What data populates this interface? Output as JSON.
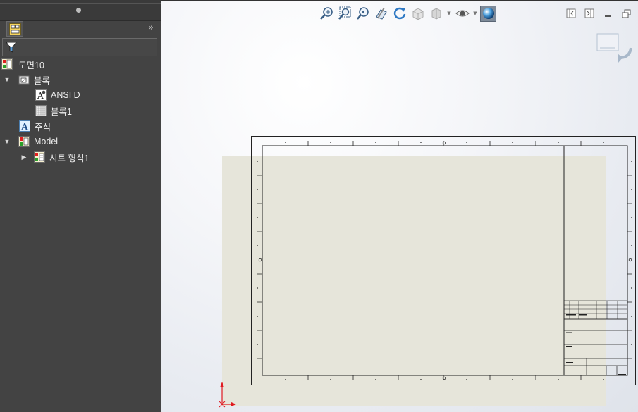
{
  "feature_tree": {
    "items": [
      {
        "label": "도면10",
        "icon": "drawing-document-icon",
        "expander": ""
      },
      {
        "label": "블록",
        "icon": "blocks-folder-icon",
        "expander": "▼"
      },
      {
        "label": "ANSI D",
        "icon": "block-icon",
        "expander": ""
      },
      {
        "label": "블록1",
        "icon": "block-icon",
        "expander": ""
      },
      {
        "label": "주석",
        "icon": "annotations-icon",
        "expander": ""
      },
      {
        "label": "Model",
        "icon": "model-icon",
        "expander": "▼"
      },
      {
        "label": "시트 형식1",
        "icon": "sheet-format-icon",
        "expander": "▶"
      }
    ]
  },
  "heads_up_toolbar": {
    "buttons": [
      "zoom-to-fit-icon",
      "zoom-to-area-icon",
      "previous-view-icon",
      "section-view-icon",
      "rotate-view-icon",
      "view-orientation-icon",
      "display-style-icon",
      "hide-show-items-icon",
      "apply-scene-icon"
    ]
  },
  "colors": {
    "panel_bg": "#434343",
    "sheet_bg": "#e6e5da",
    "accent_red": "#e0191f"
  }
}
